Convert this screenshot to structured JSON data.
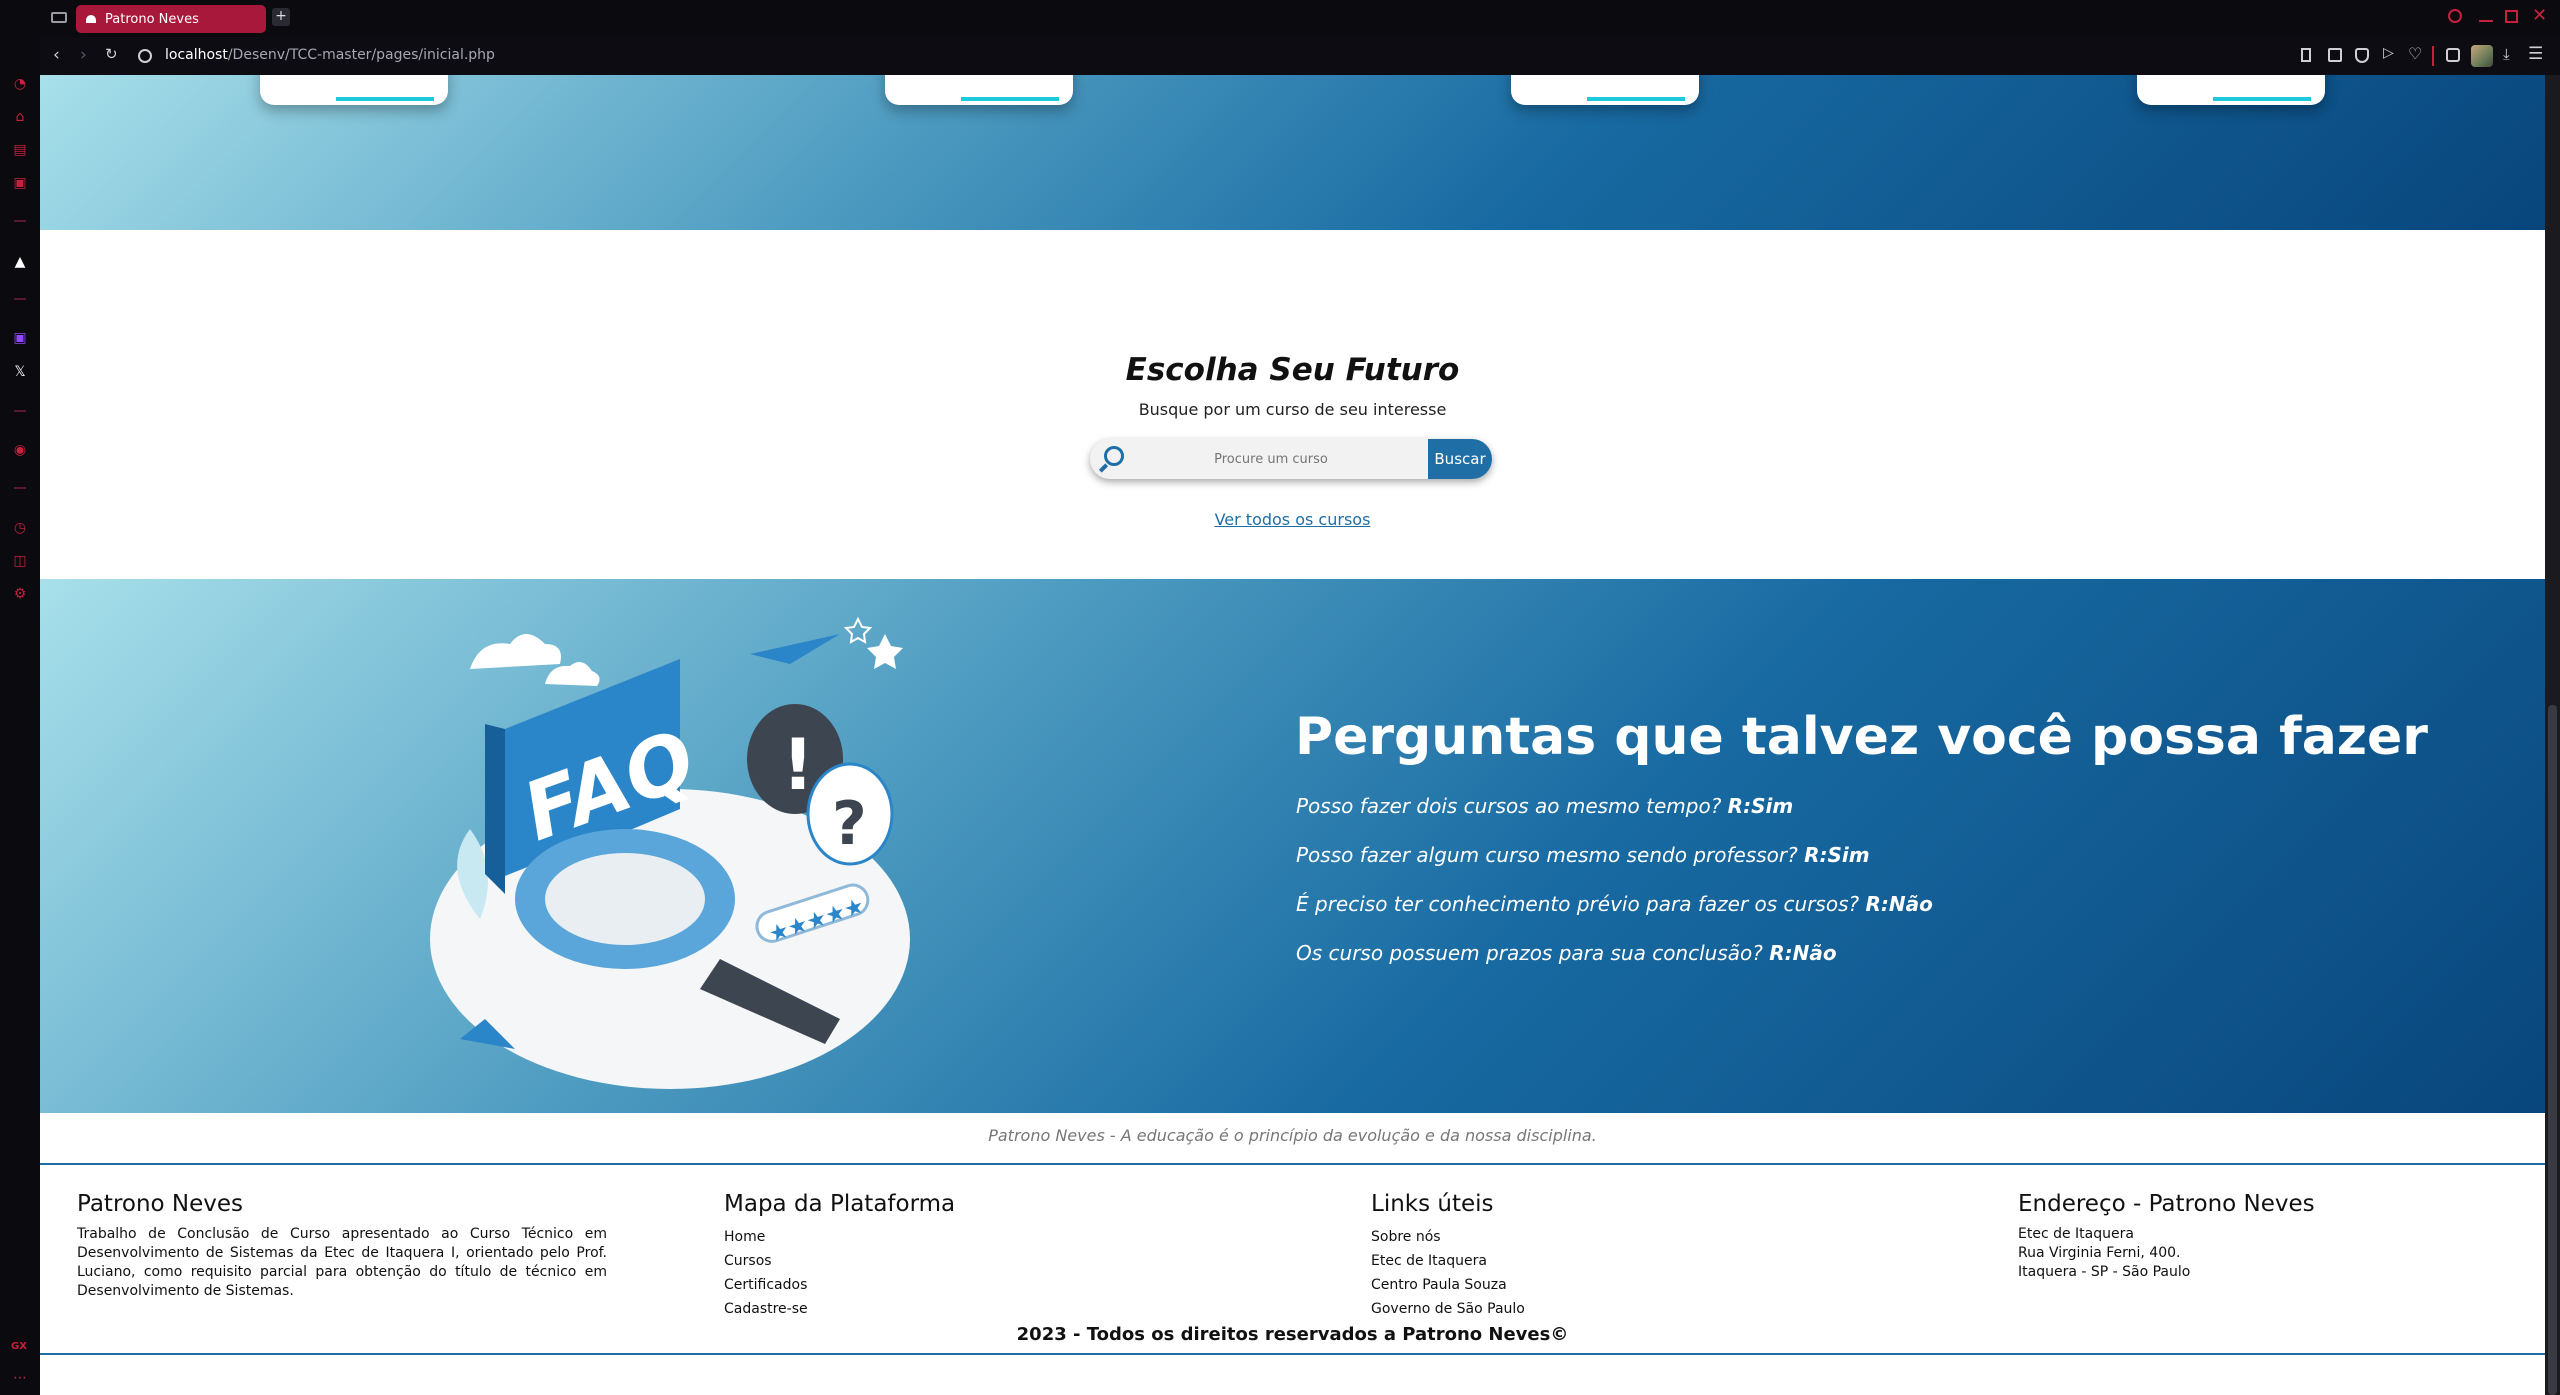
{
  "browser": {
    "tab_title": "Patrono Neves",
    "url_host": "localhost",
    "url_path": "/Desenv/TCC-master/pages/inicial.php",
    "new_tab": "+",
    "sidebar_badge": "GX"
  },
  "search_section": {
    "title": "Escolha Seu Futuro",
    "subtitle": "Busque por um curso de seu interesse",
    "placeholder": "Procure um curso",
    "button": "Buscar",
    "link": "Ver todos os cursos"
  },
  "faq": {
    "title": "Perguntas que talvez você possa fazer",
    "items": [
      {
        "q": "Posso fazer dois cursos ao mesmo tempo?",
        "a": "R:Sim"
      },
      {
        "q": "Posso fazer algum curso mesmo sendo professor?",
        "a": "R:Sim"
      },
      {
        "q": "É preciso ter conhecimento prévio para fazer os cursos?",
        "a": "R:Não"
      },
      {
        "q": "Os curso possuem prazos para sua conclusão?",
        "a": "R:Não"
      }
    ],
    "illustration_text": "FAQ"
  },
  "motto": "Patrono Neves - A educação é o princípio da evolução e da nossa disciplina.",
  "footer": {
    "about": {
      "heading": "Patrono Neves",
      "text": "Trabalho de Conclusão de Curso apresentado ao Curso Técnico em Desenvolvimento de Sistemas da Etec de Itaquera I, orientado pelo Prof. Luciano, como requisito parcial para obtenção do título de técnico em Desenvolvimento de Sistemas."
    },
    "sitemap": {
      "heading": "Mapa da Plataforma",
      "links": [
        "Home",
        "Cursos",
        "Certificados",
        "Cadastre-se"
      ]
    },
    "useful": {
      "heading": "Links úteis",
      "links": [
        "Sobre nós",
        "Etec de Itaquera",
        "Centro Paula Souza",
        "Governo de São Paulo"
      ]
    },
    "address": {
      "heading": "Endereço - Patrono Neves",
      "lines": [
        "Etec de Itaquera",
        "Rua Virginia Ferni, 400.",
        "Itaquera - SP - São Paulo"
      ]
    },
    "copyright": "2023 - Todos os direitos reservados a Patrono Neves©"
  },
  "colors": {
    "accent": "#c8203f",
    "brand_blue": "#156399",
    "tab": "#a8183a"
  }
}
